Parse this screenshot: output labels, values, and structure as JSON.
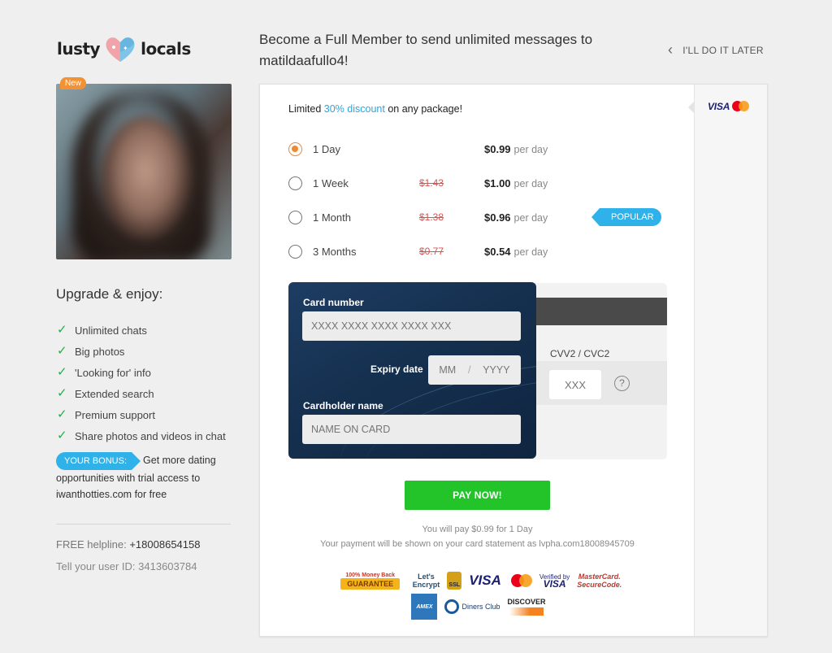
{
  "brand": {
    "word_left": "lusty",
    "word_right": "locals"
  },
  "profile": {
    "badge": "New"
  },
  "sidebar": {
    "upgrade_title": "Upgrade & enjoy:",
    "features": [
      "Unlimited chats",
      "Big photos",
      "'Looking for' info",
      "Extended search",
      "Premium support",
      "Share photos and videos in chat"
    ],
    "bonus_tag": "YOUR BONUS:",
    "bonus_text_1": "Get more dating",
    "bonus_text_2": "opportunities with trial access to iwanthotties.com for free",
    "helpline_label": "FREE helpline:",
    "helpline_number": "+18008654158",
    "user_id_text": "Tell your user ID: 3413603784"
  },
  "header": {
    "headline": "Become a Full Member to send unlimited messages to matildaafullo4!",
    "later": "I'LL DO IT LATER"
  },
  "payment_methods": {
    "visa": "VISA"
  },
  "promo": {
    "prefix": "Limited",
    "highlight": "30% discount",
    "suffix": "on any package!"
  },
  "plans": [
    {
      "name": "1 Day",
      "old_price": "",
      "price": "$0.99",
      "per": "per day",
      "selected": true
    },
    {
      "name": "1 Week",
      "old_price": "$1.43",
      "price": "$1.00",
      "per": "per day",
      "selected": false
    },
    {
      "name": "1 Month",
      "old_price": "$1.38",
      "price": "$0.96",
      "per": "per day",
      "selected": false
    },
    {
      "name": "3 Months",
      "old_price": "$0.77",
      "price": "$0.54",
      "per": "per day",
      "selected": false
    }
  ],
  "popular_tag": "POPULAR",
  "card": {
    "number_label": "Card number",
    "number_placeholder": "XXXX XXXX XXXX XXXX XXX",
    "expiry_label": "Expiry date",
    "expiry_month": "MM",
    "expiry_sep": "/",
    "expiry_year": "YYYY",
    "holder_label": "Cardholder name",
    "holder_placeholder": "NAME ON CARD",
    "cvv_label": "CVV2 / CVC2",
    "cvv_placeholder": "XXX",
    "help": "?"
  },
  "pay_button": "PAY NOW!",
  "pay_summary": "You will pay $0.99 for 1 Day",
  "statement_note": "Your payment will be shown on your card statement as lvpha.com18008945709",
  "trust_badges": {
    "guarantee_top": "100% Money Back",
    "guarantee_main": "GUARANTEE",
    "letsencrypt_1": "Let's",
    "letsencrypt_2": "Encrypt",
    "ssl": "SSL",
    "visa": "VISA",
    "verified_1": "Verified by",
    "verified_2": "VISA",
    "mastercard_1": "MasterCard.",
    "mastercard_2": "SecureCode.",
    "amex": "AMEX",
    "diners": "Diners Club",
    "discover": "DISCOVER"
  }
}
